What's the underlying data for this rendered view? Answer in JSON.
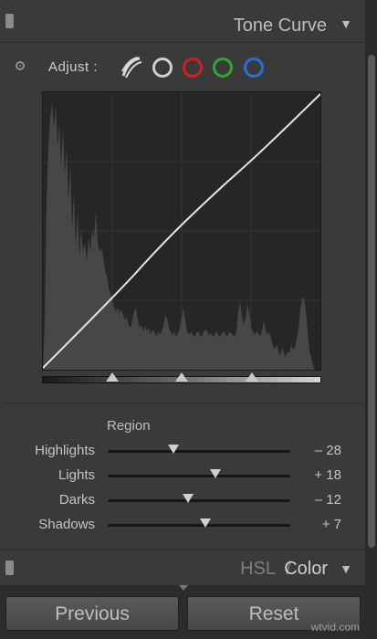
{
  "header": {
    "title": "Tone Curve"
  },
  "adjust": {
    "label": "Adjust :",
    "channels": [
      {
        "icon": "rgb-point-curve-icon"
      },
      {
        "icon": "luminance-channel-circle-icon",
        "color": "#cfcfcf"
      },
      {
        "icon": "red-channel-circle-icon",
        "color": "#d02020"
      },
      {
        "icon": "green-channel-circle-icon",
        "color": "#2fa82f"
      },
      {
        "icon": "blue-channel-circle-icon",
        "color": "#2a6fd6"
      }
    ]
  },
  "region": {
    "title": "Region",
    "sliders": [
      {
        "label": "Highlights",
        "value": "– 28",
        "level": -28
      },
      {
        "label": "Lights",
        "value": "+ 18",
        "level": 18
      },
      {
        "label": "Darks",
        "value": "– 12",
        "level": -12
      },
      {
        "label": "Shadows",
        "value": "+ 7",
        "level": 7
      }
    ],
    "split_points": [
      25,
      50,
      75
    ]
  },
  "hsl": {
    "hsl_label": "HSL",
    "slash": "/",
    "color_label": "Color"
  },
  "buttons": {
    "previous": "Previous",
    "reset": "Reset"
  },
  "watermark": "wtvid.com"
}
